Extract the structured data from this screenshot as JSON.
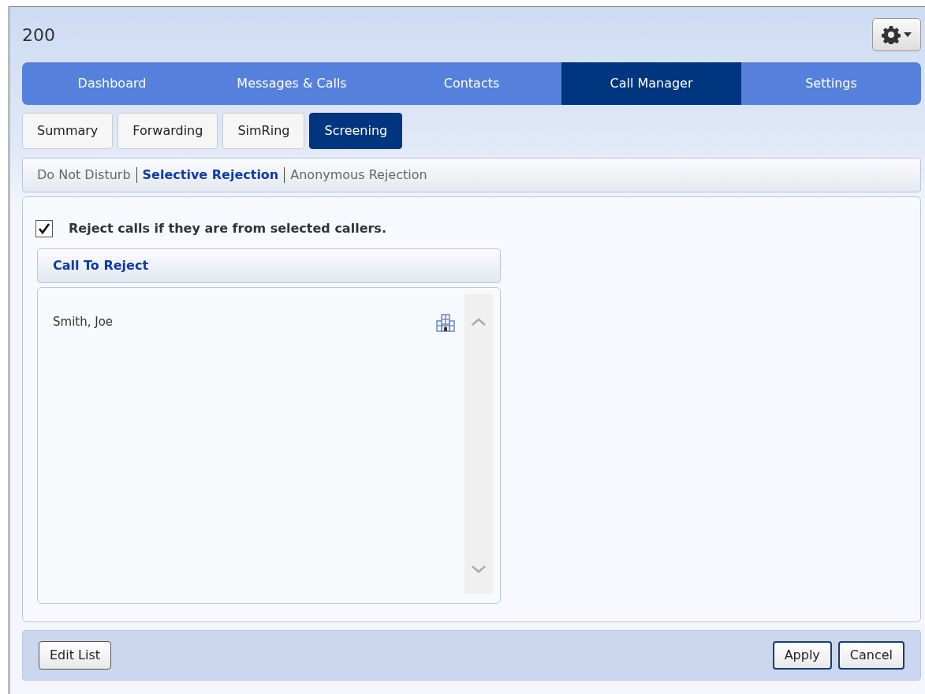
{
  "window": {
    "title": "200"
  },
  "main_tabs": [
    {
      "label": "Dashboard",
      "selected": false
    },
    {
      "label": "Messages & Calls",
      "selected": false
    },
    {
      "label": "Contacts",
      "selected": false
    },
    {
      "label": "Call Manager",
      "selected": true
    },
    {
      "label": "Settings",
      "selected": false
    }
  ],
  "sub_tabs": [
    {
      "label": "Summary",
      "selected": false
    },
    {
      "label": "Forwarding",
      "selected": false
    },
    {
      "label": "SimRing",
      "selected": false
    },
    {
      "label": "Screening",
      "selected": true
    }
  ],
  "screening_links": [
    {
      "label": "Do Not Disturb",
      "selected": false
    },
    {
      "label": "Selective Rejection",
      "selected": true
    },
    {
      "label": "Anonymous Rejection",
      "selected": false
    }
  ],
  "reject_option": {
    "label": "Reject calls if they are from selected callers.",
    "checked": true
  },
  "reject_list": {
    "header": "Call To Reject",
    "items": [
      {
        "name": "Smith, Joe"
      }
    ]
  },
  "footer": {
    "left_buttons": [
      "Edit List"
    ],
    "right_buttons": [
      "Apply",
      "Cancel"
    ]
  }
}
